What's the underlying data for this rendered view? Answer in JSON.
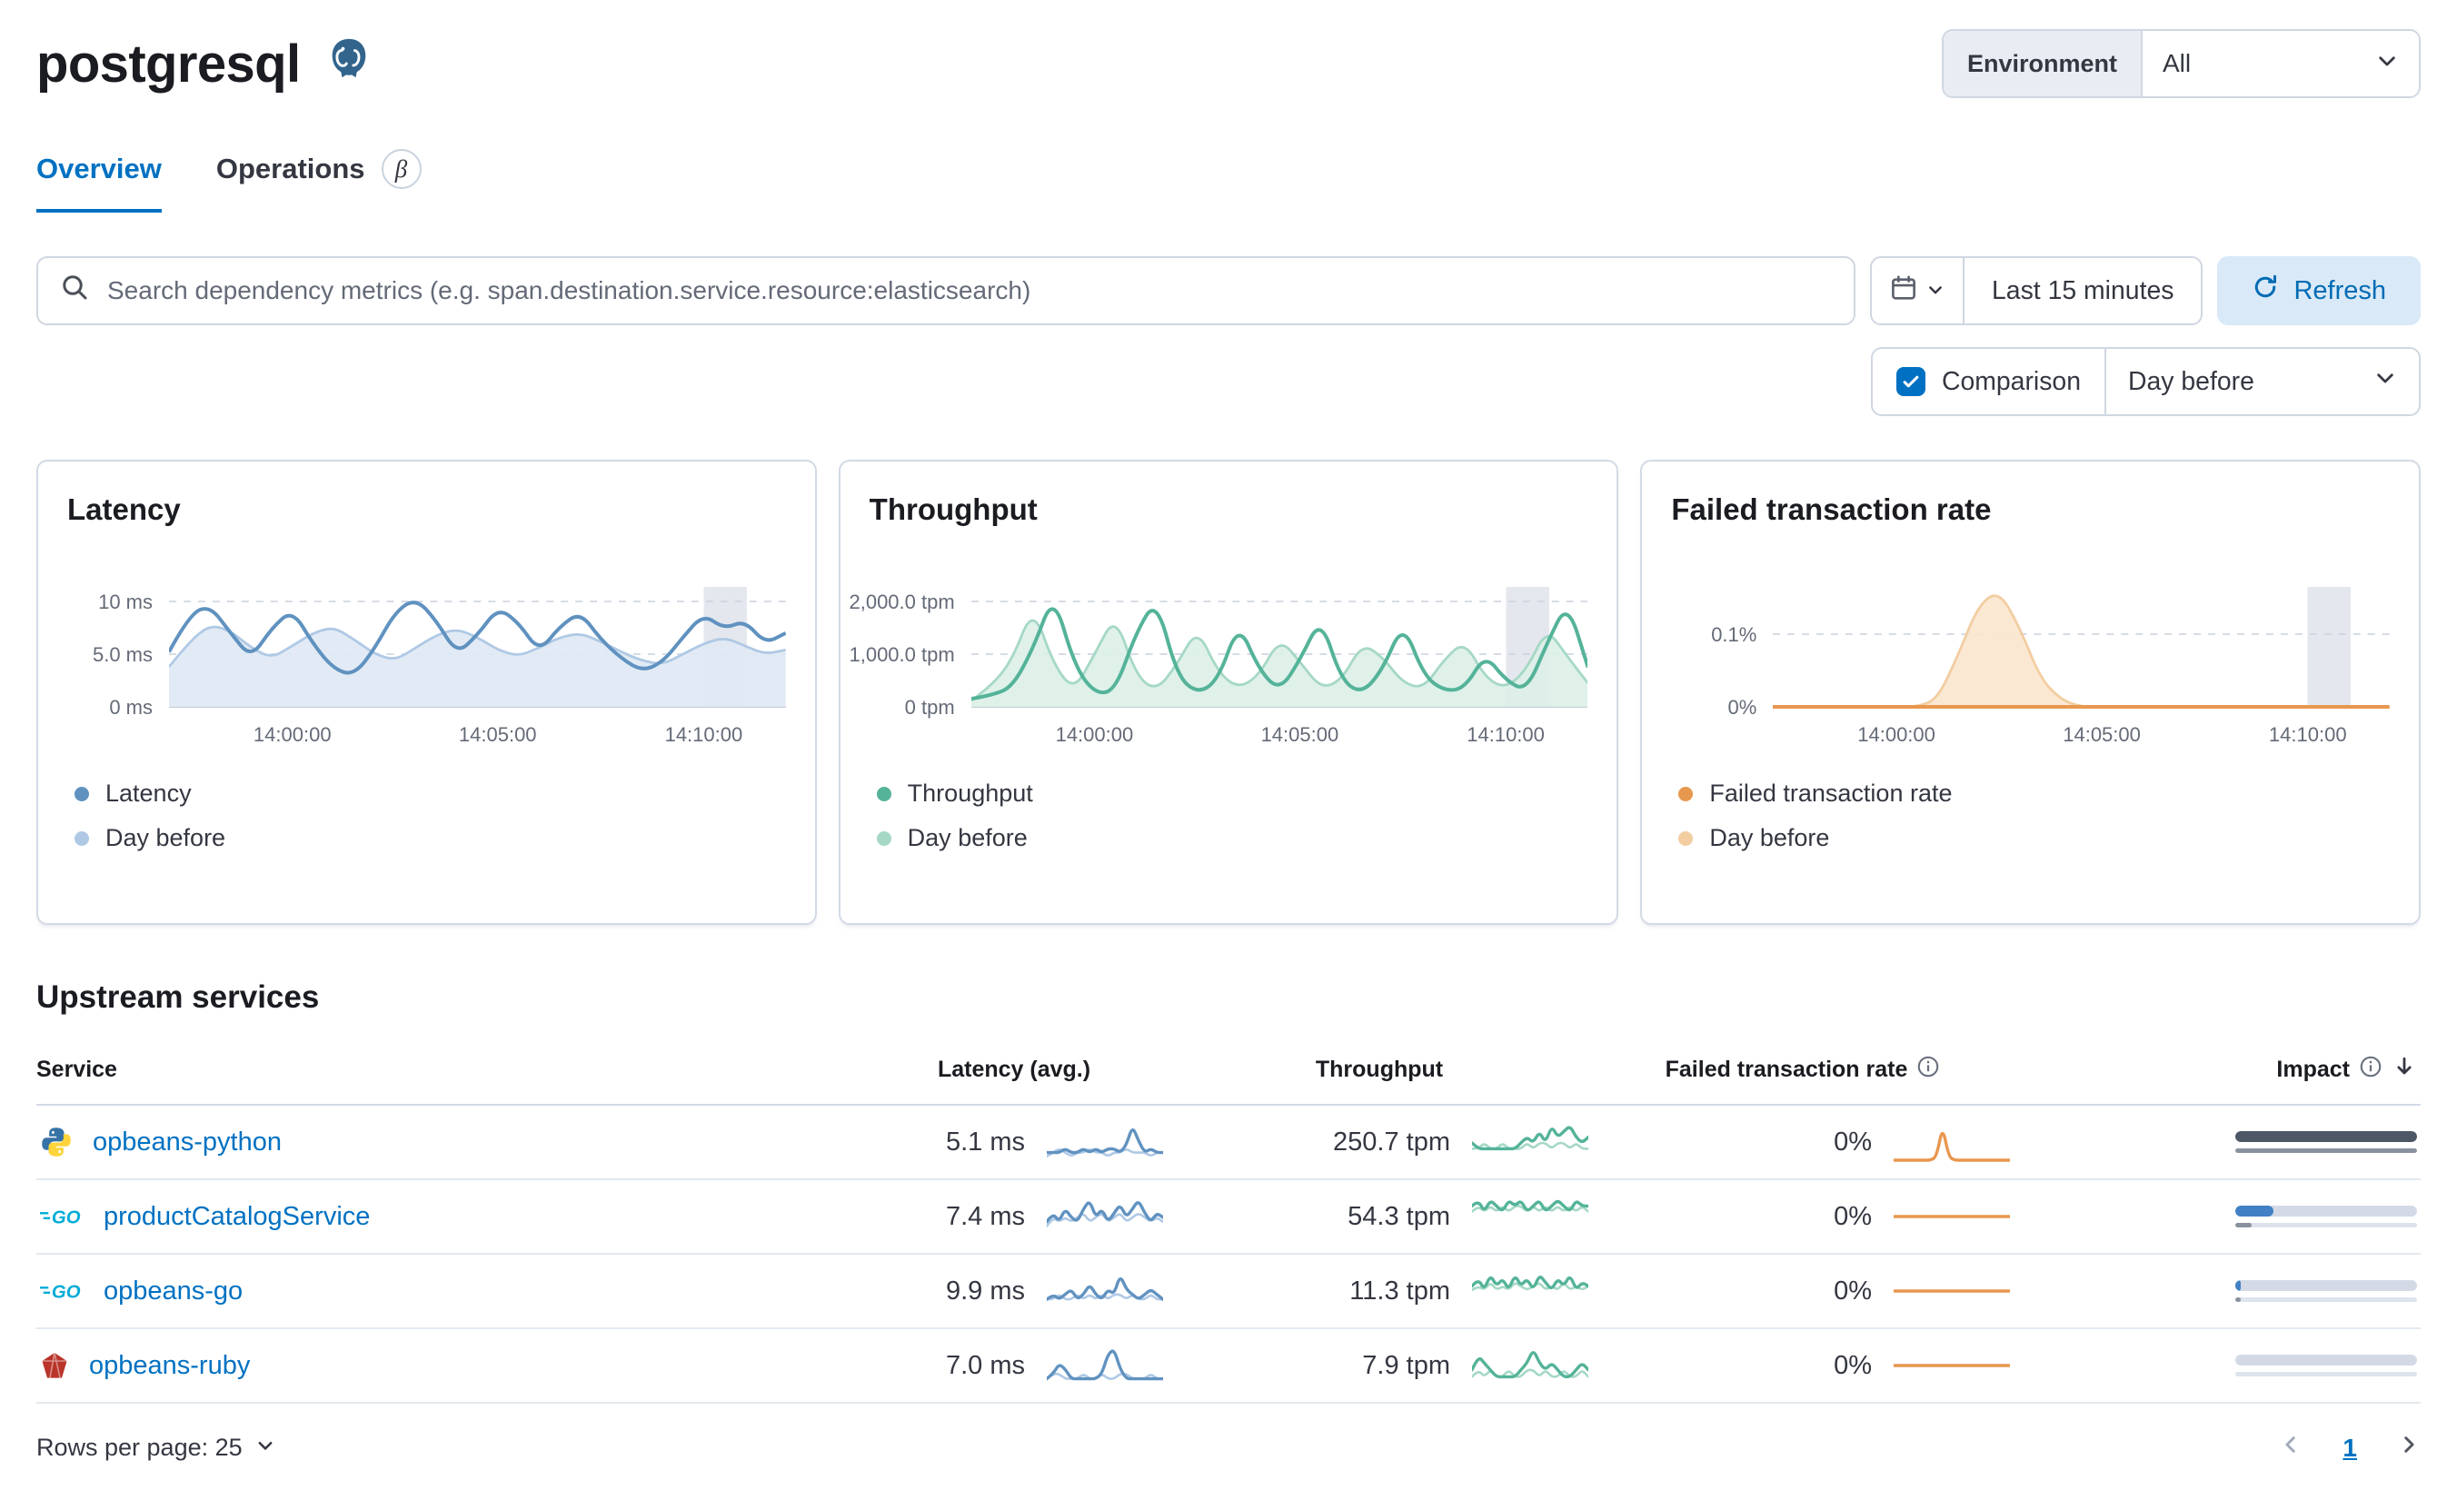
{
  "colors": {
    "accent": "#0071c2",
    "latency": "#6092c0",
    "latency_prev": "#afc9e5",
    "throughput": "#54b399",
    "throughput_prev": "#a5d8c5",
    "failed": "#e8974f",
    "failed_prev": "#f2cda1"
  },
  "header": {
    "title": "postgresql",
    "environment_label": "Environment",
    "environment_value": "All"
  },
  "tabs": [
    {
      "label": "Overview",
      "active": true
    },
    {
      "label": "Operations",
      "beta": "β"
    }
  ],
  "toolbar": {
    "search_placeholder": "Search dependency metrics (e.g. span.destination.service.resource:elasticsearch)",
    "time_range": "Last 15 minutes",
    "refresh_label": "Refresh",
    "comparison_label": "Comparison",
    "comparison_value": "Day before"
  },
  "charts": [
    {
      "title": "Latency",
      "type": "line",
      "y_ticks": [
        {
          "label": "10 ms",
          "value": 10,
          "y": 8
        },
        {
          "label": "5.0 ms",
          "value": 5,
          "y": 37
        },
        {
          "label": "0 ms",
          "value": 0,
          "y": 66
        }
      ],
      "x_ticks": [
        {
          "label": "14:00:00",
          "pos": 0.2
        },
        {
          "label": "14:05:00",
          "pos": 0.533
        },
        {
          "label": "14:10:00",
          "pos": 0.867
        }
      ],
      "band": {
        "from": 0.867,
        "to": 0.937
      },
      "series": [
        {
          "name": "Day before",
          "type": "area",
          "color": "#afc9e5",
          "fill": "#dfe9f4",
          "values": [
            3.8,
            6.2,
            7.8,
            7.2,
            5.6,
            4.6,
            5.8,
            7.0,
            7.6,
            6.4,
            5.0,
            4.4,
            5.6,
            6.8,
            7.4,
            6.6,
            5.4,
            4.8,
            5.6,
            6.6,
            7.0,
            6.2,
            5.2,
            4.4,
            4.0,
            5.0,
            6.0,
            6.6,
            5.8,
            5.0,
            5.4
          ]
        },
        {
          "name": "Latency",
          "type": "line",
          "color": "#6092c0",
          "values": [
            5.2,
            8.8,
            9.6,
            7.0,
            4.6,
            7.5,
            9.2,
            6.0,
            3.6,
            3.0,
            5.5,
            9.0,
            10.3,
            8.2,
            5.0,
            6.8,
            9.4,
            8.0,
            5.2,
            7.6,
            9.0,
            6.4,
            4.6,
            3.4,
            4.2,
            6.6,
            8.8,
            7.4,
            8.2,
            6.0,
            7.0
          ]
        }
      ],
      "legend": [
        {
          "label": "Latency",
          "color": "#6092c0"
        },
        {
          "label": "Day before",
          "color": "#afc9e5"
        }
      ]
    },
    {
      "title": "Throughput",
      "type": "line",
      "y_ticks": [
        {
          "label": "2,000.0 tpm",
          "value": 2000,
          "y": 8
        },
        {
          "label": "1,000.0 tpm",
          "value": 1000,
          "y": 37
        },
        {
          "label": "0 tpm",
          "value": 0,
          "y": 66
        }
      ],
      "x_ticks": [
        {
          "label": "14:00:00",
          "pos": 0.2
        },
        {
          "label": "14:05:00",
          "pos": 0.533
        },
        {
          "label": "14:10:00",
          "pos": 0.867
        }
      ],
      "band": {
        "from": 0.867,
        "to": 0.937
      },
      "series": [
        {
          "name": "Day before",
          "type": "area",
          "color": "#a5d8c5",
          "fill": "#dcefe7",
          "values": [
            120,
            400,
            900,
            1900,
            800,
            300,
            1000,
            1750,
            600,
            300,
            800,
            1500,
            650,
            350,
            600,
            1300,
            850,
            350,
            500,
            1200,
            950,
            450,
            350,
            900,
            1250,
            550,
            350,
            700,
            1500,
            950,
            450
          ]
        },
        {
          "name": "Throughput",
          "type": "line",
          "color": "#54b399",
          "values": [
            150,
            220,
            380,
            1100,
            2150,
            800,
            250,
            300,
            1400,
            2050,
            600,
            250,
            500,
            1600,
            700,
            300,
            900,
            1700,
            500,
            250,
            700,
            1600,
            600,
            300,
            350,
            1000,
            500,
            300,
            1200,
            2000,
            750
          ]
        }
      ],
      "legend": [
        {
          "label": "Throughput",
          "color": "#54b399"
        },
        {
          "label": "Day before",
          "color": "#a5d8c5"
        }
      ]
    },
    {
      "title": "Failed transaction rate",
      "type": "line",
      "y_ticks": [
        {
          "label": "0.1%",
          "value": 0.1,
          "y": 26
        },
        {
          "label": "0%",
          "value": 0,
          "y": 66
        }
      ],
      "x_ticks": [
        {
          "label": "14:00:00",
          "pos": 0.2
        },
        {
          "label": "14:05:00",
          "pos": 0.533
        },
        {
          "label": "14:10:00",
          "pos": 0.867
        }
      ],
      "band": {
        "from": 0.867,
        "to": 0.937
      },
      "series": [
        {
          "name": "Day before",
          "type": "area",
          "color": "#f2cda1",
          "fill": "#f9e6cd",
          "values": [
            0,
            0,
            0,
            0,
            0,
            0,
            0,
            0,
            0.01,
            0.07,
            0.14,
            0.16,
            0.11,
            0.04,
            0.01,
            0,
            0,
            0,
            0,
            0,
            0,
            0,
            0,
            0,
            0,
            0,
            0,
            0,
            0,
            0,
            0
          ]
        },
        {
          "name": "Failed transaction rate",
          "type": "line",
          "color": "#e8974f",
          "values": [
            0,
            0,
            0,
            0,
            0,
            0,
            0,
            0,
            0,
            0,
            0,
            0,
            0,
            0,
            0,
            0,
            0,
            0,
            0,
            0,
            0,
            0,
            0,
            0,
            0,
            0,
            0,
            0,
            0,
            0,
            0
          ]
        }
      ],
      "legend": [
        {
          "label": "Failed transaction rate",
          "color": "#e8974f"
        },
        {
          "label": "Day before",
          "color": "#f2cda1"
        }
      ]
    }
  ],
  "table": {
    "section_title": "Upstream services",
    "columns": {
      "service": "Service",
      "latency": "Latency (avg.)",
      "throughput": "Throughput",
      "failed": "Failed transaction rate",
      "impact": "Impact"
    },
    "rows": [
      {
        "service": "opbeans-python",
        "icon": "python",
        "latency": "5.1 ms",
        "latency_spark": {
          "main": [
            2,
            2,
            2,
            3,
            2,
            2,
            3,
            2,
            3,
            2,
            3,
            3,
            2,
            4,
            9,
            5,
            2,
            3,
            2,
            2
          ],
          "prev": [
            1,
            2,
            3,
            2,
            1,
            2,
            2,
            3,
            2,
            2,
            1,
            2,
            2,
            3,
            2,
            2,
            2,
            1,
            2,
            2
          ]
        },
        "throughput": "250.7 tpm",
        "throughput_spark": {
          "main": [
            3,
            2,
            2,
            2,
            2,
            2,
            2,
            2,
            3,
            4,
            3,
            5,
            3,
            6,
            4,
            5,
            6,
            4,
            3,
            4
          ],
          "prev": [
            2,
            2,
            3,
            2,
            2,
            3,
            2,
            2,
            2,
            3,
            2,
            3,
            3,
            2,
            3,
            3,
            2,
            3,
            2,
            2
          ]
        },
        "failed_rate": "0%",
        "failed_spark": {
          "main": [
            0,
            0,
            0,
            0,
            0,
            0,
            0,
            0.5,
            5,
            0.5,
            0,
            0,
            0,
            0,
            0,
            0,
            0,
            0,
            0,
            0
          ]
        },
        "impact": {
          "value": 100,
          "prev": 100,
          "color": "#4d5766"
        }
      },
      {
        "service": "productCatalogService",
        "icon": "go",
        "latency": "7.4 ms",
        "latency_spark": {
          "main": [
            3,
            5,
            3,
            6,
            4,
            3,
            6,
            8,
            4,
            6,
            3,
            5,
            7,
            4,
            6,
            8,
            5,
            3,
            5,
            4
          ],
          "prev": [
            2,
            4,
            3,
            4,
            3,
            4,
            5,
            3,
            4,
            5,
            3,
            4,
            5,
            3,
            4,
            5,
            4,
            3,
            4,
            3
          ]
        },
        "throughput": "54.3 tpm",
        "throughput_spark": {
          "main": [
            5,
            6,
            4,
            6,
            5,
            4,
            6,
            5,
            6,
            4,
            5,
            6,
            4,
            5,
            6,
            5,
            4,
            6,
            5,
            5
          ],
          "prev": [
            4,
            5,
            4,
            5,
            4,
            5,
            4,
            5,
            5,
            4,
            5,
            4,
            5,
            4,
            5,
            4,
            5,
            4,
            5,
            4
          ]
        },
        "failed_rate": "0%",
        "failed_spark": {
          "main": [
            0,
            0,
            0,
            0,
            0,
            0,
            0,
            0,
            0,
            0,
            0,
            0,
            0,
            0,
            0,
            0,
            0,
            0,
            0,
            0
          ]
        },
        "impact": {
          "value": 21,
          "prev": 9,
          "color": "#4180c4"
        }
      },
      {
        "service": "opbeans-go",
        "icon": "go",
        "latency": "9.9 ms",
        "latency_spark": {
          "main": [
            2,
            3,
            2,
            3,
            4,
            2,
            3,
            5,
            3,
            2,
            4,
            3,
            7,
            4,
            3,
            2,
            3,
            4,
            3,
            2
          ],
          "prev": [
            2,
            2,
            3,
            2,
            2,
            3,
            2,
            3,
            2,
            3,
            2,
            3,
            3,
            2,
            3,
            2,
            2,
            3,
            2,
            2
          ]
        },
        "throughput": "11.3 tpm",
        "throughput_spark": {
          "main": [
            6,
            8,
            5,
            9,
            6,
            8,
            5,
            9,
            6,
            8,
            5,
            9,
            7,
            5,
            8,
            6,
            9,
            5,
            7,
            6
          ],
          "prev": [
            5,
            6,
            5,
            7,
            5,
            6,
            5,
            7,
            6,
            5,
            6,
            7,
            5,
            6,
            5,
            7,
            5,
            6,
            5,
            6
          ]
        },
        "failed_rate": "0%",
        "failed_spark": {
          "main": [
            0,
            0,
            0,
            0,
            0,
            0,
            0,
            0,
            0,
            0,
            0,
            0,
            0,
            0,
            0,
            0,
            0,
            0,
            0,
            0
          ]
        },
        "impact": {
          "value": 3,
          "prev": 3,
          "color": "#4180c4"
        }
      },
      {
        "service": "opbeans-ruby",
        "icon": "ruby",
        "latency": "7.0 ms",
        "latency_spark": {
          "main": [
            1,
            2,
            4,
            3,
            1,
            1,
            1,
            1,
            1,
            2,
            6,
            7,
            3,
            1,
            1,
            1,
            1,
            1,
            1,
            1
          ],
          "prev": [
            1,
            2,
            2,
            1,
            1,
            1,
            2,
            1,
            1,
            2,
            1,
            1,
            2,
            2,
            1,
            1,
            1,
            2,
            1,
            1
          ]
        },
        "throughput": "7.9 tpm",
        "throughput_spark": {
          "main": [
            2,
            4,
            3,
            2,
            1,
            1,
            1,
            1,
            2,
            3,
            5,
            3,
            2,
            3,
            2,
            1,
            1,
            2,
            3,
            2
          ],
          "prev": [
            1,
            2,
            1,
            2,
            1,
            1,
            2,
            1,
            1,
            2,
            2,
            1,
            2,
            1,
            1,
            2,
            1,
            1,
            2,
            1
          ]
        },
        "failed_rate": "0%",
        "failed_spark": {
          "main": [
            0,
            0,
            0,
            0,
            0,
            0,
            0,
            0,
            0,
            0,
            0,
            0,
            0,
            0,
            0,
            0,
            0,
            0,
            0,
            0
          ]
        },
        "impact": {
          "value": 0,
          "prev": 0,
          "color": "#4180c4"
        }
      }
    ]
  },
  "footer": {
    "rows_per_page_label": "Rows per page: 25",
    "page": "1"
  }
}
